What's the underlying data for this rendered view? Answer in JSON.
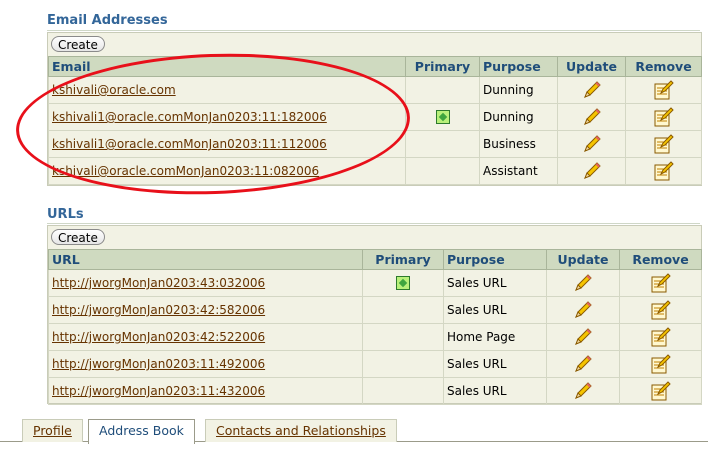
{
  "email_section": {
    "title": "Email Addresses",
    "create_label": "Create",
    "columns": [
      "Email",
      "Primary",
      "Purpose",
      "Update",
      "Remove"
    ],
    "rows": [
      {
        "email": "kshivali@oracle.com",
        "primary": false,
        "purpose": "Dunning"
      },
      {
        "email": "kshivali1@oracle.comMonJan0203:11:182006",
        "primary": true,
        "purpose": "Dunning"
      },
      {
        "email": "kshivali1@oracle.comMonJan0203:11:112006",
        "primary": false,
        "purpose": "Business"
      },
      {
        "email": "kshivali@oracle.comMonJan0203:11:082006",
        "primary": false,
        "purpose": "Assistant"
      }
    ]
  },
  "url_section": {
    "title": "URLs",
    "create_label": "Create",
    "columns": [
      "URL",
      "Primary",
      "Purpose",
      "Update",
      "Remove"
    ],
    "rows": [
      {
        "url": "http://jworgMonJan0203:43:032006",
        "primary": true,
        "purpose": "Sales URL"
      },
      {
        "url": "http://jworgMonJan0203:42:582006",
        "primary": false,
        "purpose": "Sales URL"
      },
      {
        "url": "http://jworgMonJan0203:42:522006",
        "primary": false,
        "purpose": "Home Page"
      },
      {
        "url": "http://jworgMonJan0203:11:492006",
        "primary": false,
        "purpose": "Sales URL"
      },
      {
        "url": "http://jworgMonJan0203:11:432006",
        "primary": false,
        "purpose": "Sales URL"
      }
    ]
  },
  "tabs": [
    {
      "label": "Profile",
      "active": false
    },
    {
      "label": "Address Book",
      "active": true
    },
    {
      "label": "Contacts and Relationships",
      "active": false
    }
  ],
  "icons": {
    "update": "pencil-icon",
    "remove": "notepad-icon",
    "primary": "primary-check-icon"
  },
  "colors": {
    "header_bg": "#cfdac0",
    "title_blue": "#336699",
    "link_brown": "#663300",
    "annotation_red": "#e8101a"
  }
}
